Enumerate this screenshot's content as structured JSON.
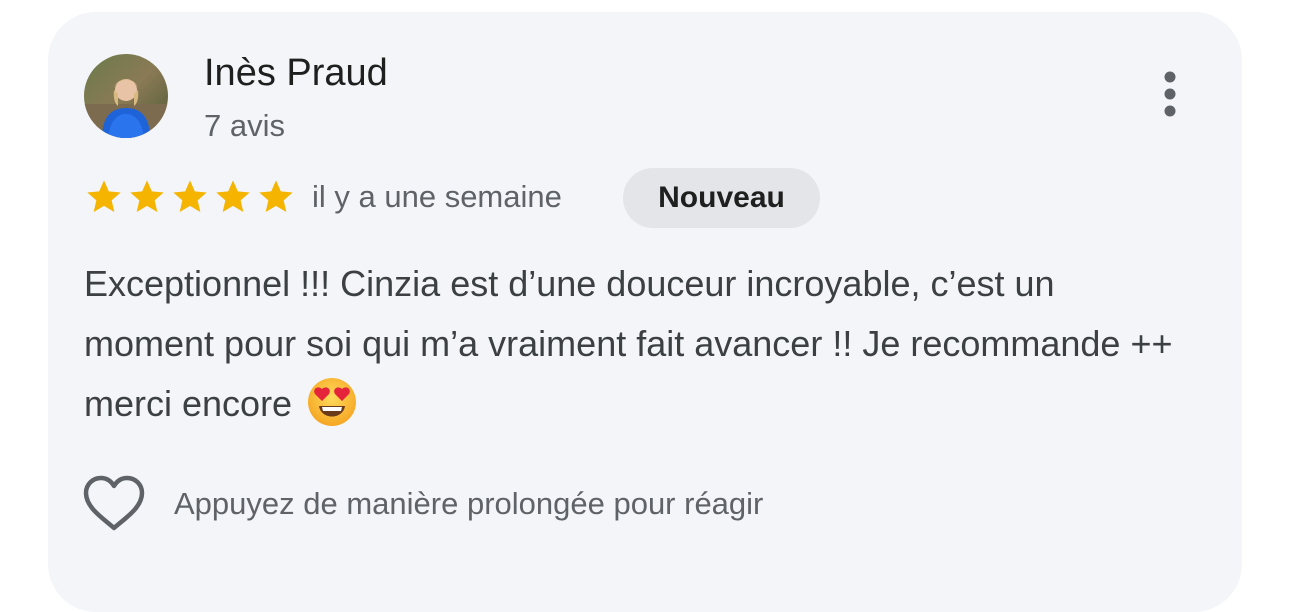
{
  "review": {
    "author": {
      "name": "Inès Praud",
      "review_count": "7 avis",
      "avatar_icon": "profile-photo"
    },
    "rating": 5,
    "max_rating": 5,
    "time_ago": "il y a une semaine",
    "badge": "Nouveau",
    "text": "Exceptionnel !!! Cinzia est d’une douceur incroyable, c’est un moment pour soi qui m’a vraiment fait avancer !! Je recommande ++ merci encore",
    "emoji_icon": "heart-eyes-emoji",
    "reaction_hint": "Appuyez de manière prolongée pour réagir",
    "reaction_icon": "heart-outline-icon",
    "menu_icon": "more-vertical-icon"
  },
  "colors": {
    "card_background": "#f3f5f8",
    "star": "#f4b400",
    "badge_background": "#e3e5e8",
    "primary_text": "#1f1f1f",
    "secondary_text": "#5f6368"
  }
}
